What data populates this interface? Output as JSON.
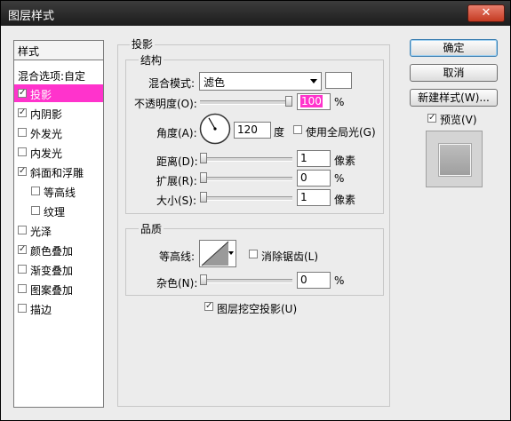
{
  "window": {
    "title": "图层样式",
    "close": "✕"
  },
  "left": {
    "header": "样式",
    "items": [
      {
        "label": "混合选项:自定",
        "checkbox": false,
        "checked": false,
        "selected": false,
        "indent": false
      },
      {
        "label": "投影",
        "checkbox": true,
        "checked": true,
        "selected": true,
        "indent": false
      },
      {
        "label": "内阴影",
        "checkbox": true,
        "checked": true,
        "selected": false,
        "indent": false
      },
      {
        "label": "外发光",
        "checkbox": true,
        "checked": false,
        "selected": false,
        "indent": false
      },
      {
        "label": "内发光",
        "checkbox": true,
        "checked": false,
        "selected": false,
        "indent": false
      },
      {
        "label": "斜面和浮雕",
        "checkbox": true,
        "checked": true,
        "selected": false,
        "indent": false
      },
      {
        "label": "等高线",
        "checkbox": true,
        "checked": false,
        "selected": false,
        "indent": true
      },
      {
        "label": "纹理",
        "checkbox": true,
        "checked": false,
        "selected": false,
        "indent": true
      },
      {
        "label": "光泽",
        "checkbox": true,
        "checked": false,
        "selected": false,
        "indent": false
      },
      {
        "label": "颜色叠加",
        "checkbox": true,
        "checked": true,
        "selected": false,
        "indent": false
      },
      {
        "label": "渐变叠加",
        "checkbox": true,
        "checked": false,
        "selected": false,
        "indent": false
      },
      {
        "label": "图案叠加",
        "checkbox": true,
        "checked": false,
        "selected": false,
        "indent": false
      },
      {
        "label": "描边",
        "checkbox": true,
        "checked": false,
        "selected": false,
        "indent": false
      }
    ]
  },
  "main": {
    "section_title": "投影",
    "structure": {
      "title": "结构",
      "blend_mode_label": "混合模式:",
      "blend_mode_value": "滤色",
      "opacity_label": "不透明度(O):",
      "opacity_value": "100",
      "opacity_percent": 100,
      "angle_label": "角度(A):",
      "angle_value": "120",
      "angle_unit": "度",
      "global_light_label": "使用全局光(G)",
      "distance_label": "距离(D):",
      "distance_value": "1",
      "distance_unit": "像素",
      "spread_label": "扩展(R):",
      "spread_value": "0",
      "spread_unit": "%",
      "size_label": "大小(S):",
      "size_value": "1",
      "size_unit": "像素",
      "percent_sign": "%"
    },
    "quality": {
      "title": "品质",
      "contour_label": "等高线:",
      "antialias_label": "消除锯齿(L)",
      "noise_label": "杂色(N):",
      "noise_value": "0",
      "noise_unit": "%"
    },
    "knockout_label": "图层挖空投影(U)"
  },
  "right": {
    "ok": "确定",
    "cancel": "取消",
    "new_style": "新建样式(W)...",
    "preview_label": "预览(V)"
  },
  "colors": {
    "accent": "#ff33cc",
    "blend_swatch": "#ffffff",
    "title_bar": "#1c1c1c"
  }
}
